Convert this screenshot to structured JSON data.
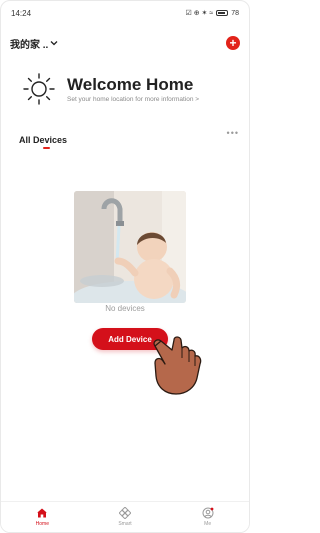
{
  "status_bar": {
    "time": "14:24",
    "icons_text": "☑ ⊕ ✶ ≈",
    "battery": "78"
  },
  "header": {
    "home_name": "我的家 ..",
    "dropdown_icon": "chevron-down-icon",
    "add_icon": "plus-circle-icon"
  },
  "welcome": {
    "title": "Welcome Home",
    "subtitle": "Set your home location for more information >",
    "icon": "sun-icon"
  },
  "devices": {
    "section_title": "All Devices",
    "more_label": "•••",
    "empty_text": "No devices",
    "add_button": "Add Device"
  },
  "tabs": [
    {
      "label": "Home",
      "icon": "home-icon",
      "active": true
    },
    {
      "label": "Smart",
      "icon": "smart-icon",
      "active": false
    },
    {
      "label": "Me",
      "icon": "profile-icon",
      "active": false
    }
  ],
  "colors": {
    "accent": "#d4101a",
    "text": "#222222",
    "muted": "#9a9a9a"
  }
}
